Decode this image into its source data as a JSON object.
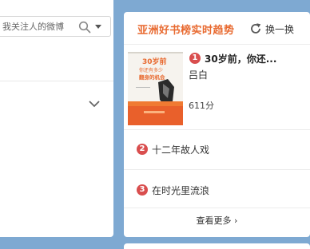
{
  "search": {
    "placeholder": "我关注人的微博"
  },
  "trend": {
    "title": "亚洲好书榜实时趋势",
    "refresh_label": "换一换",
    "items": [
      {
        "rank": "1",
        "title": "30岁前，你还...",
        "author": "吕白",
        "score": "611分",
        "cover_text": [
          "30岁前",
          "你还有多少",
          "翻身的机会"
        ]
      },
      {
        "rank": "2",
        "title": "十二年故人戏"
      },
      {
        "rank": "3",
        "title": "在时光里流浪"
      }
    ],
    "more_label": "查看更多",
    "more_arrow": "›"
  },
  "colors": {
    "background": "#7ea9d2",
    "accent": "#e8692f",
    "badge": "#d94e4e"
  }
}
